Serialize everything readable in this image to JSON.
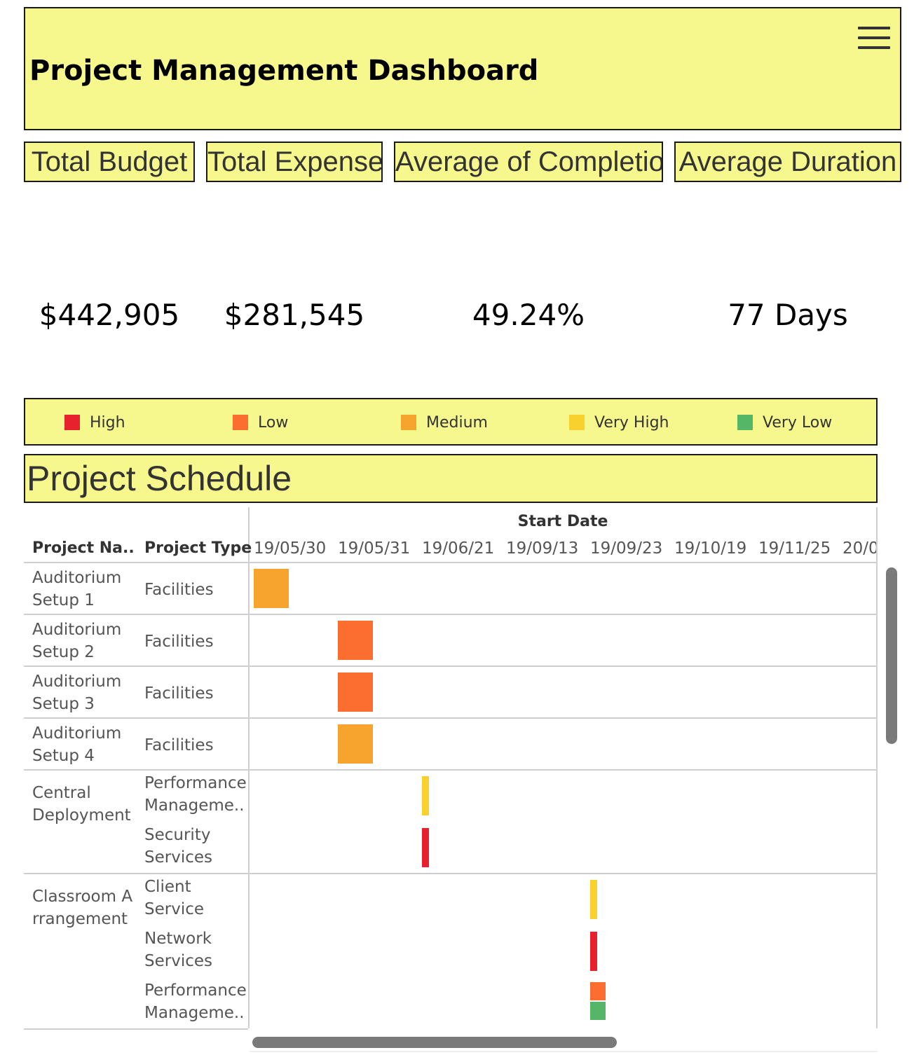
{
  "header": {
    "title": "Project Management Dashboard"
  },
  "kpis": [
    {
      "label": "Total Budget",
      "value": "$442,905"
    },
    {
      "label": "Total Expense",
      "value": "$281,545"
    },
    {
      "label": "Average of Completion",
      "value": "49.24%"
    },
    {
      "label": "Average Duration",
      "value": "77 Days"
    }
  ],
  "legend": [
    {
      "label": "High",
      "color": "#e8212e"
    },
    {
      "label": "Low",
      "color": "#fb6e2f"
    },
    {
      "label": "Medium",
      "color": "#f6a42e"
    },
    {
      "label": "Very High",
      "color": "#f8d12f"
    },
    {
      "label": "Very Low",
      "color": "#56b667"
    }
  ],
  "schedule": {
    "title": "Project Schedule",
    "start_date_header": "Start Date",
    "col_project_name": "Project Na..",
    "col_project_type": "Project Type",
    "dates": [
      "19/05/30",
      "19/05/31",
      "19/06/21",
      "19/09/13",
      "19/09/23",
      "19/10/19",
      "19/11/25",
      "20/0"
    ],
    "groups": [
      {
        "name": [
          "Auditorium",
          "Setup 1"
        ],
        "rows": [
          {
            "type": [
              "Facilities"
            ],
            "bars": [
              {
                "date": "19/05/30",
                "priority": "Medium"
              }
            ]
          }
        ]
      },
      {
        "name": [
          "Auditorium",
          "Setup 2"
        ],
        "rows": [
          {
            "type": [
              "Facilities"
            ],
            "bars": [
              {
                "date": "19/05/31",
                "priority": "Low"
              }
            ]
          }
        ]
      },
      {
        "name": [
          "Auditorium",
          "Setup 3"
        ],
        "rows": [
          {
            "type": [
              "Facilities"
            ],
            "bars": [
              {
                "date": "19/05/31",
                "priority": "Low"
              }
            ]
          }
        ]
      },
      {
        "name": [
          "Auditorium",
          "Setup 4"
        ],
        "rows": [
          {
            "type": [
              "Facilities"
            ],
            "bars": [
              {
                "date": "19/05/31",
                "priority": "Medium"
              }
            ]
          }
        ]
      },
      {
        "name": [
          "Central",
          "Deployment"
        ],
        "rows": [
          {
            "type": [
              "Performance",
              "Manageme.."
            ],
            "bars": [
              {
                "date": "19/06/21",
                "priority": "Very High"
              }
            ]
          },
          {
            "type": [
              "Security",
              "Services"
            ],
            "bars": [
              {
                "date": "19/06/21",
                "priority": "High"
              }
            ]
          }
        ]
      },
      {
        "name": [
          "Classroom A",
          "rrangement"
        ],
        "rows": [
          {
            "type": [
              "Client",
              "Service"
            ],
            "bars": [
              {
                "date": "19/09/23",
                "priority": "Very High"
              }
            ]
          },
          {
            "type": [
              "Network",
              "Services"
            ],
            "bars": [
              {
                "date": "19/09/23",
                "priority": "High"
              }
            ]
          },
          {
            "type": [
              "Performance",
              "Manageme.."
            ],
            "bars": [
              {
                "date": "19/09/23",
                "priority": "Low"
              },
              {
                "date": "19/09/23",
                "priority": "Very Low"
              }
            ]
          }
        ]
      }
    ]
  }
}
